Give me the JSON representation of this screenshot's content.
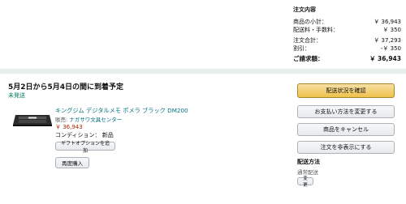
{
  "summary": {
    "title": "注文内容",
    "rows": [
      {
        "label": "商品の小計：",
        "value": "￥ 36,943"
      },
      {
        "label": "配送料・手数料：",
        "value": "￥ 350"
      },
      {
        "label": "注文合計：",
        "value": "￥ 37,293"
      },
      {
        "label": "割引：",
        "value": "-￥ 350"
      }
    ],
    "total_label": "ご請求額：",
    "total_value": "￥ 36,943"
  },
  "shipment": {
    "delivery_title": "5月2日から5月4日の間に到着予定",
    "status": "未発送",
    "product_name": "キングジム デジタルメモ ポメラ ブラック DM200",
    "seller_prefix": "販売: ",
    "seller_name": "ナガサワ文具センター",
    "price": "￥ 36,943",
    "condition": "コンディション： 新品",
    "gift_button": "ギフトオプションを追加",
    "rebuy_button": "再度購入"
  },
  "actions": {
    "track": "配送状況を確認",
    "change_payment": "お支払い方法を変更する",
    "cancel": "商品をキャンセル",
    "hide_order": "注文を非表示にする"
  },
  "shipping_method": {
    "title": "配送方法",
    "value": "通常配送",
    "change_button": "変更"
  },
  "colors": {
    "accent_link": "#007185",
    "price": "#b12704",
    "status": "#067d62",
    "primary_button": "#f0c14b"
  }
}
